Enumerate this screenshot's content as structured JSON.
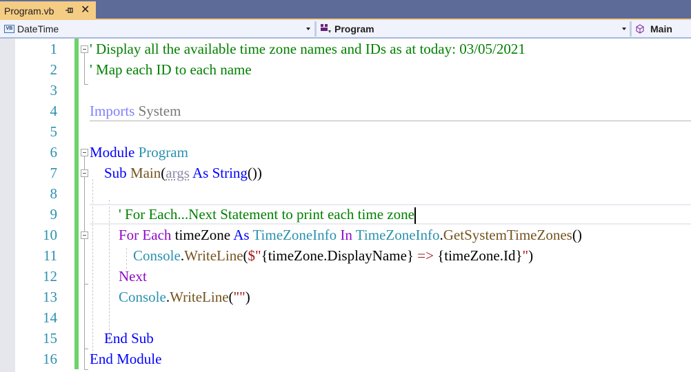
{
  "tab": {
    "title": "Program.vb",
    "pin_icon": "pin-icon",
    "close_icon": "close-icon"
  },
  "navbar": {
    "project": {
      "icon": "vb-project-icon",
      "icon_text": "VB",
      "label": "DateTime"
    },
    "type": {
      "icon": "module-icon",
      "label": "Program"
    },
    "member": {
      "icon": "method-cube-icon",
      "label": "Main"
    }
  },
  "editor": {
    "line_numbers": [
      "1",
      "2",
      "3",
      "4",
      "5",
      "6",
      "7",
      "8",
      "9",
      "10",
      "11",
      "12",
      "13",
      "14",
      "15",
      "16"
    ],
    "current_line": 9,
    "lines": [
      [
        {
          "t": "' Display all the available time zone names and IDs as at today: 03/05/2021",
          "c": "comment"
        }
      ],
      [
        {
          "t": "' Map each ID to each name",
          "c": "comment"
        }
      ],
      [],
      [
        {
          "t": "Imports",
          "c": "import"
        },
        {
          "t": " System",
          "c": "ns"
        }
      ],
      [],
      [
        {
          "t": "Module",
          "c": "kw"
        },
        {
          "t": " Program",
          "c": "type"
        }
      ],
      [
        {
          "t": "    "
        },
        {
          "t": "Sub",
          "c": "kw"
        },
        {
          "t": " "
        },
        {
          "t": "Main",
          "c": "method"
        },
        {
          "t": "(",
          "c": "plain"
        },
        {
          "t": "args",
          "c": "param"
        },
        {
          "t": " "
        },
        {
          "t": "As",
          "c": "kw"
        },
        {
          "t": " "
        },
        {
          "t": "String",
          "c": "kw"
        },
        {
          "t": "())",
          "c": "plain"
        }
      ],
      [],
      [
        {
          "t": "        "
        },
        {
          "t": "' For Each...Next Statement to print each time zone",
          "c": "comment"
        }
      ],
      [
        {
          "t": "        "
        },
        {
          "t": "For Each",
          "c": "kwctrl"
        },
        {
          "t": " timeZone ",
          "c": "plain"
        },
        {
          "t": "As",
          "c": "kw"
        },
        {
          "t": " "
        },
        {
          "t": "TimeZoneInfo",
          "c": "type"
        },
        {
          "t": " "
        },
        {
          "t": "In",
          "c": "kwctrl"
        },
        {
          "t": " "
        },
        {
          "t": "TimeZoneInfo",
          "c": "type"
        },
        {
          "t": ".",
          "c": "plain"
        },
        {
          "t": "GetSystemTimeZones",
          "c": "method"
        },
        {
          "t": "()",
          "c": "plain"
        }
      ],
      [
        {
          "t": "            "
        },
        {
          "t": "Console",
          "c": "type"
        },
        {
          "t": ".",
          "c": "plain"
        },
        {
          "t": "WriteLine",
          "c": "method"
        },
        {
          "t": "(",
          "c": "plain"
        },
        {
          "t": "$\"",
          "c": "str"
        },
        {
          "t": "{timeZone.DisplayName}",
          "c": "plain"
        },
        {
          "t": " => ",
          "c": "str"
        },
        {
          "t": "{timeZone.Id}",
          "c": "plain"
        },
        {
          "t": "\"",
          "c": "str"
        },
        {
          "t": ")",
          "c": "plain"
        }
      ],
      [
        {
          "t": "        "
        },
        {
          "t": "Next",
          "c": "kwctrl"
        }
      ],
      [
        {
          "t": "        "
        },
        {
          "t": "Console",
          "c": "type"
        },
        {
          "t": ".",
          "c": "plain"
        },
        {
          "t": "WriteLine",
          "c": "method"
        },
        {
          "t": "(",
          "c": "plain"
        },
        {
          "t": "\"\"",
          "c": "str"
        },
        {
          "t": ")",
          "c": "plain"
        }
      ],
      [],
      [
        {
          "t": "    "
        },
        {
          "t": "End Sub",
          "c": "kw"
        }
      ],
      [
        {
          "t": "End Module",
          "c": "kw"
        }
      ]
    ]
  },
  "colors": {
    "tab_active": "#f5cc84",
    "tabstrip_bg": "#5d6b99",
    "change_bar": "#6bd36b",
    "line_number": "#2b91af",
    "comment": "#008000",
    "keyword": "#0000ff",
    "control_keyword": "#8f08c4",
    "type": "#2b91af",
    "method": "#74531f",
    "string": "#a31515"
  }
}
